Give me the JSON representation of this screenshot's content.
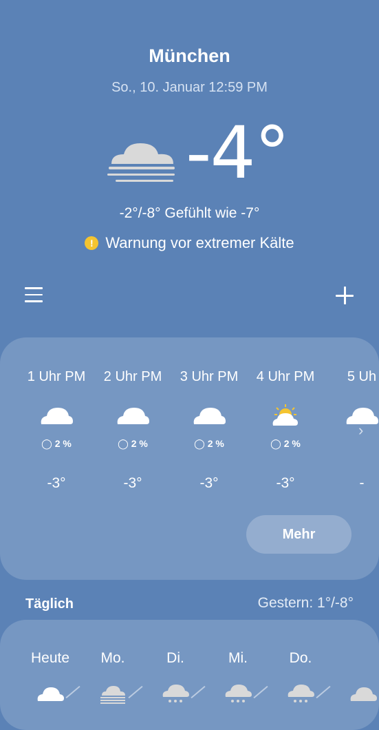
{
  "location": {
    "city": "München",
    "datetime": "So., 10. Januar 12:59 PM"
  },
  "current": {
    "temperature": "-4°",
    "condition_icon": "fog-icon",
    "minmax_feels": "-2°/-8° Gefühlt wie -7°",
    "warning": "Warnung vor extremer Kälte",
    "warning_icon": "warning-icon"
  },
  "toolbar": {
    "menu_icon": "menu-icon",
    "add_icon": "add-icon"
  },
  "hourly": {
    "hours": [
      {
        "label": "1 Uhr PM",
        "icon": "cloud-icon",
        "precip": "2 %",
        "temp": "-3°"
      },
      {
        "label": "2 Uhr PM",
        "icon": "cloud-icon",
        "precip": "2 %",
        "temp": "-3°"
      },
      {
        "label": "3 Uhr PM",
        "icon": "cloud-icon",
        "precip": "2 %",
        "temp": "-3°"
      },
      {
        "label": "4 Uhr PM",
        "icon": "partly-sunny-icon",
        "precip": "2 %",
        "temp": "-3°"
      },
      {
        "label": "5 Uh",
        "icon": "cloud-icon",
        "precip": "",
        "temp": "-"
      }
    ],
    "more_label": "Mehr"
  },
  "daily": {
    "title": "Täglich",
    "yesterday": "Gestern: 1°/-8°",
    "days": [
      {
        "label": "Heute",
        "icon": "cloud-icon"
      },
      {
        "label": "Mo.",
        "icon": "fog-icon"
      },
      {
        "label": "Di.",
        "icon": "snow-icon"
      },
      {
        "label": "Mi.",
        "icon": "snow-icon"
      },
      {
        "label": "Do.",
        "icon": "snow-icon"
      },
      {
        "label": "",
        "icon": "cloud-icon"
      }
    ]
  },
  "colors": {
    "background": "#5b82b6",
    "card": "rgba(255,255,255,0.17)",
    "sun": "#f4c430"
  }
}
